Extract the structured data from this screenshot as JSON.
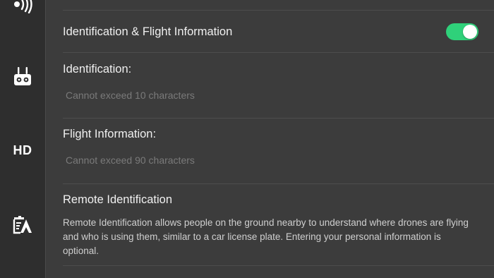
{
  "sidebar": {
    "items": [
      {
        "icon": "signal-transmission-icon"
      },
      {
        "icon": "remote-controller-icon"
      },
      {
        "icon": "hd-icon",
        "label": "HD"
      },
      {
        "icon": "flight-info-icon"
      }
    ]
  },
  "settings": {
    "id_flight_info": {
      "label": "Identification & Flight Information",
      "toggle_on": true,
      "toggle_color": "#2fd17a"
    },
    "identification": {
      "label": "Identification:",
      "placeholder": "Cannot exceed 10 characters"
    },
    "flight_information": {
      "label": "Flight Information:",
      "placeholder": "Cannot exceed 90 characters"
    },
    "remote_identification": {
      "label": "Remote Identification",
      "description": "Remote Identification allows people on the ground nearby to understand where drones are flying and who is using them, similar to a car license plate. Entering your personal information is optional."
    }
  }
}
